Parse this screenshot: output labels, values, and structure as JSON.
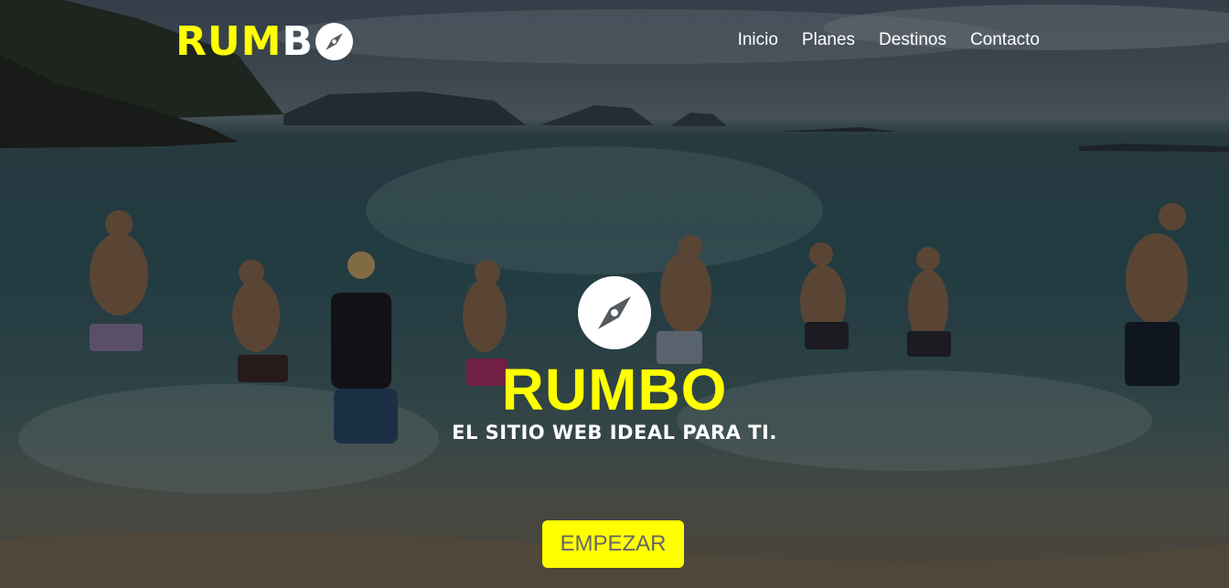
{
  "brand": {
    "logo_text_yellow": "RUM",
    "logo_text_white": "B",
    "logo_icon": "compass-icon",
    "accent_color": "#ffff00"
  },
  "nav": {
    "items": [
      {
        "label": "Inicio"
      },
      {
        "label": "Planes"
      },
      {
        "label": "Destinos"
      },
      {
        "label": "Contacto"
      }
    ]
  },
  "hero": {
    "background": "beach-photo",
    "icon": "compass-icon",
    "title": "RUMBO",
    "subtitle": "EL SITIO WEB IDEAL PARA TI.",
    "cta_label": "EMPEZAR"
  }
}
